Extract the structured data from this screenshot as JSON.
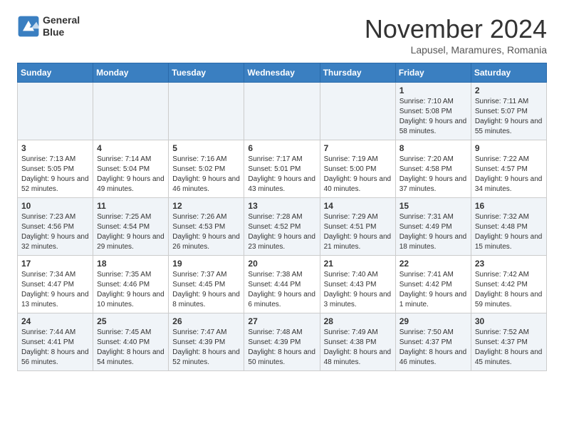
{
  "logo": {
    "line1": "General",
    "line2": "Blue"
  },
  "title": "November 2024",
  "subtitle": "Lapusel, Maramures, Romania",
  "days_of_week": [
    "Sunday",
    "Monday",
    "Tuesday",
    "Wednesday",
    "Thursday",
    "Friday",
    "Saturday"
  ],
  "weeks": [
    [
      {
        "day": "",
        "info": ""
      },
      {
        "day": "",
        "info": ""
      },
      {
        "day": "",
        "info": ""
      },
      {
        "day": "",
        "info": ""
      },
      {
        "day": "",
        "info": ""
      },
      {
        "day": "1",
        "info": "Sunrise: 7:10 AM\nSunset: 5:08 PM\nDaylight: 9 hours\nand 58 minutes."
      },
      {
        "day": "2",
        "info": "Sunrise: 7:11 AM\nSunset: 5:07 PM\nDaylight: 9 hours\nand 55 minutes."
      }
    ],
    [
      {
        "day": "3",
        "info": "Sunrise: 7:13 AM\nSunset: 5:05 PM\nDaylight: 9 hours\nand 52 minutes."
      },
      {
        "day": "4",
        "info": "Sunrise: 7:14 AM\nSunset: 5:04 PM\nDaylight: 9 hours\nand 49 minutes."
      },
      {
        "day": "5",
        "info": "Sunrise: 7:16 AM\nSunset: 5:02 PM\nDaylight: 9 hours\nand 46 minutes."
      },
      {
        "day": "6",
        "info": "Sunrise: 7:17 AM\nSunset: 5:01 PM\nDaylight: 9 hours\nand 43 minutes."
      },
      {
        "day": "7",
        "info": "Sunrise: 7:19 AM\nSunset: 5:00 PM\nDaylight: 9 hours\nand 40 minutes."
      },
      {
        "day": "8",
        "info": "Sunrise: 7:20 AM\nSunset: 4:58 PM\nDaylight: 9 hours\nand 37 minutes."
      },
      {
        "day": "9",
        "info": "Sunrise: 7:22 AM\nSunset: 4:57 PM\nDaylight: 9 hours\nand 34 minutes."
      }
    ],
    [
      {
        "day": "10",
        "info": "Sunrise: 7:23 AM\nSunset: 4:56 PM\nDaylight: 9 hours\nand 32 minutes."
      },
      {
        "day": "11",
        "info": "Sunrise: 7:25 AM\nSunset: 4:54 PM\nDaylight: 9 hours\nand 29 minutes."
      },
      {
        "day": "12",
        "info": "Sunrise: 7:26 AM\nSunset: 4:53 PM\nDaylight: 9 hours\nand 26 minutes."
      },
      {
        "day": "13",
        "info": "Sunrise: 7:28 AM\nSunset: 4:52 PM\nDaylight: 9 hours\nand 23 minutes."
      },
      {
        "day": "14",
        "info": "Sunrise: 7:29 AM\nSunset: 4:51 PM\nDaylight: 9 hours\nand 21 minutes."
      },
      {
        "day": "15",
        "info": "Sunrise: 7:31 AM\nSunset: 4:49 PM\nDaylight: 9 hours\nand 18 minutes."
      },
      {
        "day": "16",
        "info": "Sunrise: 7:32 AM\nSunset: 4:48 PM\nDaylight: 9 hours\nand 15 minutes."
      }
    ],
    [
      {
        "day": "17",
        "info": "Sunrise: 7:34 AM\nSunset: 4:47 PM\nDaylight: 9 hours\nand 13 minutes."
      },
      {
        "day": "18",
        "info": "Sunrise: 7:35 AM\nSunset: 4:46 PM\nDaylight: 9 hours\nand 10 minutes."
      },
      {
        "day": "19",
        "info": "Sunrise: 7:37 AM\nSunset: 4:45 PM\nDaylight: 9 hours\nand 8 minutes."
      },
      {
        "day": "20",
        "info": "Sunrise: 7:38 AM\nSunset: 4:44 PM\nDaylight: 9 hours\nand 6 minutes."
      },
      {
        "day": "21",
        "info": "Sunrise: 7:40 AM\nSunset: 4:43 PM\nDaylight: 9 hours\nand 3 minutes."
      },
      {
        "day": "22",
        "info": "Sunrise: 7:41 AM\nSunset: 4:42 PM\nDaylight: 9 hours\nand 1 minute."
      },
      {
        "day": "23",
        "info": "Sunrise: 7:42 AM\nSunset: 4:42 PM\nDaylight: 8 hours\nand 59 minutes."
      }
    ],
    [
      {
        "day": "24",
        "info": "Sunrise: 7:44 AM\nSunset: 4:41 PM\nDaylight: 8 hours\nand 56 minutes."
      },
      {
        "day": "25",
        "info": "Sunrise: 7:45 AM\nSunset: 4:40 PM\nDaylight: 8 hours\nand 54 minutes."
      },
      {
        "day": "26",
        "info": "Sunrise: 7:47 AM\nSunset: 4:39 PM\nDaylight: 8 hours\nand 52 minutes."
      },
      {
        "day": "27",
        "info": "Sunrise: 7:48 AM\nSunset: 4:39 PM\nDaylight: 8 hours\nand 50 minutes."
      },
      {
        "day": "28",
        "info": "Sunrise: 7:49 AM\nSunset: 4:38 PM\nDaylight: 8 hours\nand 48 minutes."
      },
      {
        "day": "29",
        "info": "Sunrise: 7:50 AM\nSunset: 4:37 PM\nDaylight: 8 hours\nand 46 minutes."
      },
      {
        "day": "30",
        "info": "Sunrise: 7:52 AM\nSunset: 4:37 PM\nDaylight: 8 hours\nand 45 minutes."
      }
    ]
  ]
}
